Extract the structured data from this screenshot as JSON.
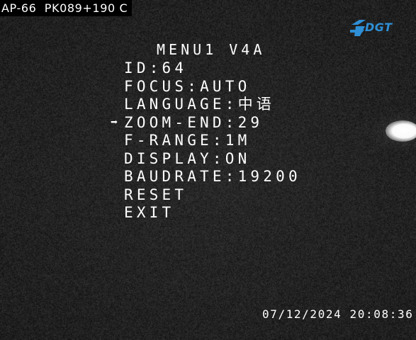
{
  "overlay": {
    "camera_label": "AP-66  PK089+190 C",
    "logo_text": "DGT",
    "timestamp": "07/12/2024 20:08:36"
  },
  "menu": {
    "title": "MENU1 V4A",
    "cursor_glyph": "➡",
    "selected_index": 3,
    "items": [
      {
        "label": "ID",
        "value": "64"
      },
      {
        "label": "FOCUS",
        "value": "AUTO"
      },
      {
        "label": "LANGUAGE",
        "value": "中语"
      },
      {
        "label": "ZOOM-END",
        "value": "29"
      },
      {
        "label": "F-RANGE",
        "value": "1M"
      },
      {
        "label": "DISPLAY",
        "value": "ON"
      },
      {
        "label": "BAUDRATE",
        "value": "19200"
      },
      {
        "label": "RESET",
        "value": null
      },
      {
        "label": "EXIT",
        "value": null
      }
    ]
  },
  "colors": {
    "osd_text": "#ffffff",
    "logo_blue": "#2e8fd6",
    "background": "#1d1d1d"
  }
}
